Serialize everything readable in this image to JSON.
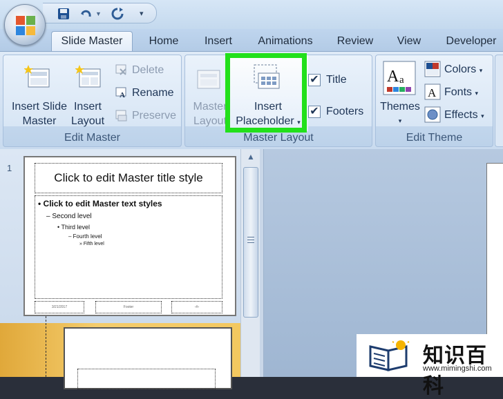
{
  "quick_access": {
    "save_icon": "save-icon",
    "undo_icon": "undo-icon",
    "redo_icon": "redo-icon",
    "customize_icon": "customize-icon"
  },
  "tabs": [
    {
      "label": "Slide Master",
      "active": true
    },
    {
      "label": "Home"
    },
    {
      "label": "Insert"
    },
    {
      "label": "Animations"
    },
    {
      "label": "Review"
    },
    {
      "label": "View"
    },
    {
      "label": "Developer"
    }
  ],
  "groups": {
    "edit_master": {
      "label": "Edit Master",
      "insert_slide_master": [
        "Insert Slide",
        "Master"
      ],
      "insert_layout": [
        "Insert",
        "Layout"
      ],
      "delete": "Delete",
      "rename": "Rename",
      "preserve": "Preserve"
    },
    "master_layout": {
      "label": "Master Layout",
      "master": [
        "Master",
        "Layout"
      ],
      "insert_placeholder": [
        "Insert",
        "Placeholder"
      ],
      "title": "Title",
      "footers": "Footers"
    },
    "edit_theme": {
      "label": "Edit Theme",
      "themes": "Themes",
      "colors": "Colors",
      "fonts": "Fonts",
      "effects": "Effects"
    }
  },
  "highlight_color": "#22e01b",
  "slides_pane": {
    "slide_number": "1",
    "title_placeholder": "Click to edit Master title style",
    "bullets": [
      "• Click to edit Master text styles",
      "– Second level",
      "• Third level",
      "– Fourth level",
      "» Fifth level"
    ],
    "footers": [
      "3/21/2017",
      "Footer",
      "‹#›"
    ]
  },
  "watermark": {
    "text": "知识百科",
    "url": "www.mimingshi.com"
  }
}
